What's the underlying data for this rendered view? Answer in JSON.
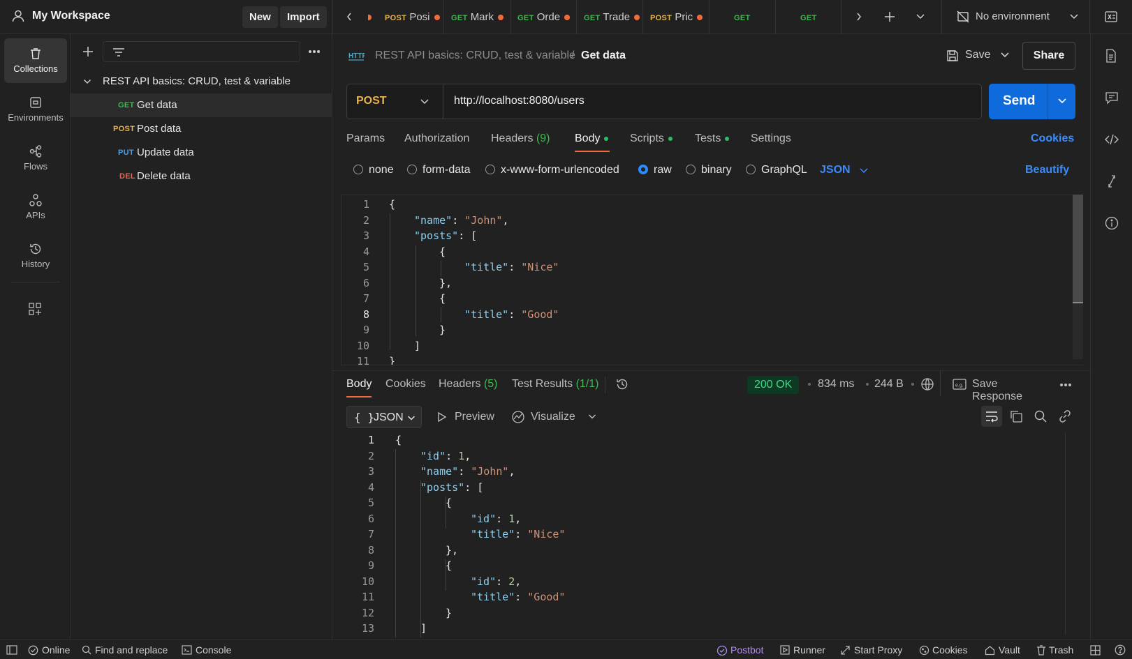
{
  "workspace": {
    "title": "My Workspace",
    "new_label": "New",
    "import_label": "Import"
  },
  "tabs": [
    {
      "method": "POST",
      "label": "Posi"
    },
    {
      "method": "GET",
      "label": "Mark"
    },
    {
      "method": "GET",
      "label": "Orde"
    },
    {
      "method": "GET",
      "label": "Trade"
    },
    {
      "method": "POST",
      "label": "Pric"
    },
    {
      "method": "GET",
      "label": ""
    },
    {
      "method": "GET",
      "label": ""
    }
  ],
  "environment": {
    "label": "No environment"
  },
  "rail": [
    {
      "label": "Collections",
      "icon": "trash-bin-icon"
    },
    {
      "label": "Environments",
      "icon": "environment-icon"
    },
    {
      "label": "Flows",
      "icon": "flows-icon"
    },
    {
      "label": "APIs",
      "icon": "apis-icon"
    },
    {
      "label": "History",
      "icon": "history-icon"
    }
  ],
  "collection": {
    "name": "REST API basics: CRUD, test & variable",
    "requests": [
      {
        "method": "GET",
        "label": "Get data"
      },
      {
        "method": "POST",
        "label": "Post data"
      },
      {
        "method": "PUT",
        "label": "Update data"
      },
      {
        "method": "DEL",
        "label": "Delete data"
      }
    ]
  },
  "request": {
    "breadcrumb_parent": "REST API basics: CRUD, test & variable",
    "breadcrumb_sep": "/",
    "name": "Get data",
    "save_label": "Save",
    "share_label": "Share",
    "method": "POST",
    "url": "http://localhost:8080/users",
    "send_label": "Send"
  },
  "request_tabs": {
    "params": "Params",
    "authorization": "Authorization",
    "headers": "Headers",
    "headers_count": "(9)",
    "body": "Body",
    "scripts": "Scripts",
    "tests": "Tests",
    "settings": "Settings",
    "cookies": "Cookies"
  },
  "body_options": {
    "none": "none",
    "form_data": "form-data",
    "urlencoded": "x-www-form-urlencoded",
    "raw": "raw",
    "binary": "binary",
    "graphql": "GraphQL",
    "format": "JSON",
    "beautify": "Beautify"
  },
  "request_body": {
    "line_numbers": [
      "1",
      "2",
      "3",
      "4",
      "5",
      "6",
      "7",
      "8",
      "9",
      "10",
      "11"
    ],
    "tokens": {
      "open": "{",
      "name_key": "\"name\"",
      "name_val": "\"John\"",
      "posts_key": "\"posts\"",
      "arr_open": "[",
      "obj_open": "{",
      "title_key": "\"title\"",
      "title1": "\"Nice\"",
      "title2": "\"Good\"",
      "obj_close_comma": "},",
      "obj_close": "}",
      "arr_close": "]",
      "close": "}"
    }
  },
  "response": {
    "tab_body": "Body",
    "tab_cookies": "Cookies",
    "tab_headers": "Headers",
    "headers_count": "(5)",
    "tab_tests": "Test Results",
    "tests_count": "(1/1)",
    "status": "200 OK",
    "time": "834 ms",
    "size": "244 B",
    "save_response": "Save Response",
    "format_label": "JSON",
    "preview_label": "Preview",
    "visualize_label": "Visualize",
    "line_numbers": [
      "1",
      "2",
      "3",
      "4",
      "5",
      "6",
      "7",
      "8",
      "9",
      "10",
      "11",
      "12",
      "13"
    ],
    "tokens": {
      "id_key": "\"id\"",
      "id1": "1",
      "id2": "2",
      "name_key": "\"name\"",
      "name_val": "\"John\"",
      "posts_key": "\"posts\"",
      "title_key": "\"title\"",
      "title1": "\"Nice\"",
      "title2": "\"Good\""
    }
  },
  "statusbar": {
    "online": "Online",
    "find_replace": "Find and replace",
    "console": "Console",
    "postbot": "Postbot",
    "runner": "Runner",
    "start_proxy": "Start Proxy",
    "cookies": "Cookies",
    "vault": "Vault",
    "trash": "Trash"
  },
  "colors": {
    "accent": "#0f6bdc",
    "link": "#3b8dff",
    "post": "#e8b44c",
    "get": "#3fb950",
    "ok_bg": "#0e3a24",
    "ok_fg": "#3ddc84"
  }
}
